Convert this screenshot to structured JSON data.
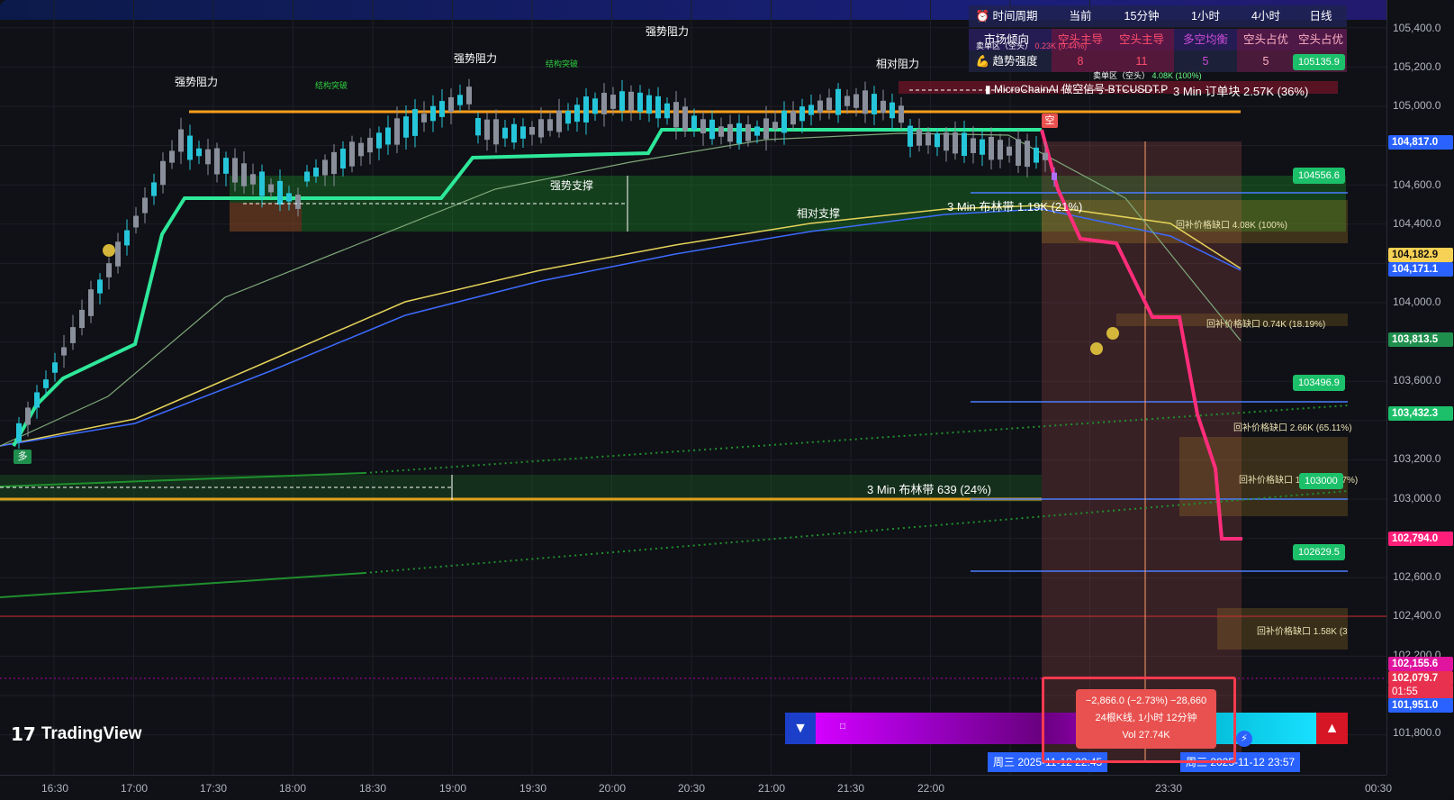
{
  "window": {
    "brand": "TradingView",
    "symbol_line": "MicroChainAI 做空信号 BTCUSDT.P"
  },
  "info_panel": {
    "header": [
      "时间周期",
      "当前",
      "15分钟",
      "1小时",
      "4小时",
      "日线"
    ],
    "row_market": {
      "label": "市场倾向",
      "values": [
        "空头主导",
        "空头主导",
        "多空均衡",
        "空头占优",
        "空头占优"
      ]
    },
    "row_trend": {
      "label": "趋势强度",
      "values": [
        "8",
        "11",
        "5",
        "5",
        ""
      ]
    },
    "sell_zone_1": "卖单区（空头）",
    "sell_zone_1_val": "0.23K (9.44%)",
    "sell_zone_2": "卖单区（空头）",
    "sell_zone_2_val": "4.08K (100%)"
  },
  "annotations": {
    "strong_resistance": "强势阻力",
    "relative_resistance": "相对阻力",
    "strong_support": "强势支撑",
    "relative_support": "相对支撑",
    "structure_break": "结构突破",
    "order_block": "3 Min 订单块 2.57K (36%)",
    "bb_top": "3 Min 布林带 1.19K (21%)",
    "bb_bottom": "3 Min 布林带 639 (24%)",
    "long_marker": "多",
    "short_marker": "空",
    "gap_1": "回补价格缺口 4.08K (100%)",
    "gap_2": "回补价格缺口 0.74K (18.19%)",
    "gap_3": "回补价格缺口 2.66K (65.11%)",
    "gap_4": "回补价格缺口 1.39K (34.07%)",
    "gap_5": "回补价格缺口 1.58K (3"
  },
  "green_tags": [
    "105135.9",
    "104556.6",
    "103496.9",
    "103000",
    "102629.5"
  ],
  "price_axis": {
    "ticks": [
      "105,400.0",
      "105,200.0",
      "105,000.0",
      "104,600.0",
      "104,400.0",
      "104,000.0",
      "103,600.0",
      "103,200.0",
      "103,000.0",
      "102,600.0",
      "102,400.0",
      "102,200.0",
      "101,800.0"
    ],
    "labels": [
      {
        "text": "104,817.0",
        "color": "#2962ff"
      },
      {
        "text": "104,556.6",
        "color": "#1cc06a"
      },
      {
        "text": "104,182.9",
        "color": "#f7d154"
      },
      {
        "text": "104,171.1",
        "color": "#2962ff"
      },
      {
        "text": "103,813.5",
        "color": "#1f8f4e"
      },
      {
        "text": "103,432.3",
        "color": "#1cc06a"
      },
      {
        "text": "102,794.0",
        "color": "#ff1f7a"
      },
      {
        "text": "102,155.6",
        "color": "#e0149e"
      },
      {
        "text": "102,079.7",
        "color": "#e8314f"
      },
      {
        "text": "01:55",
        "color": "#e8314f"
      },
      {
        "text": "101,951.0",
        "color": "#2962ff"
      }
    ]
  },
  "time_axis": [
    "16:30",
    "17:00",
    "17:30",
    "18:00",
    "18:30",
    "19:00",
    "19:30",
    "20:00",
    "20:30",
    "21:00",
    "21:30",
    "22:00",
    "23:30",
    "00:30"
  ],
  "date_flags": [
    "周三 2025-11-12  22:45",
    "周三 2025-11-12  23:57"
  ],
  "measure": {
    "line1": "−2,866.0 (−2.73%) −28,660",
    "line2": "24根K线, 1小时 12分钟",
    "line3": "Vol 27.74K"
  },
  "colors": {
    "bull": "#26c6da",
    "bear": "#8a8f9c",
    "short_candle": "#e040a0",
    "supertrend_long": "#2ee89a",
    "supertrend_short": "#ff2d7a",
    "resistance_line": "#ff9e1b"
  },
  "chart_data": {
    "type": "candlestick",
    "x_range": [
      "16:15",
      "00:45"
    ],
    "y_range": [
      101700,
      105500
    ],
    "levels": [
      {
        "name": "强势阻力",
        "value": 104980
      },
      {
        "name": "3 Min 布林带 639 (24%)",
        "value": 102990
      },
      {
        "name": "103496.9",
        "value": 103496.9
      },
      {
        "name": "102629.5",
        "value": 102629.5
      },
      {
        "name": "104556.6",
        "value": 104556.6
      }
    ],
    "last_price": 102079.7,
    "measure_change": -2866.0,
    "measure_change_pct": -2.73
  }
}
